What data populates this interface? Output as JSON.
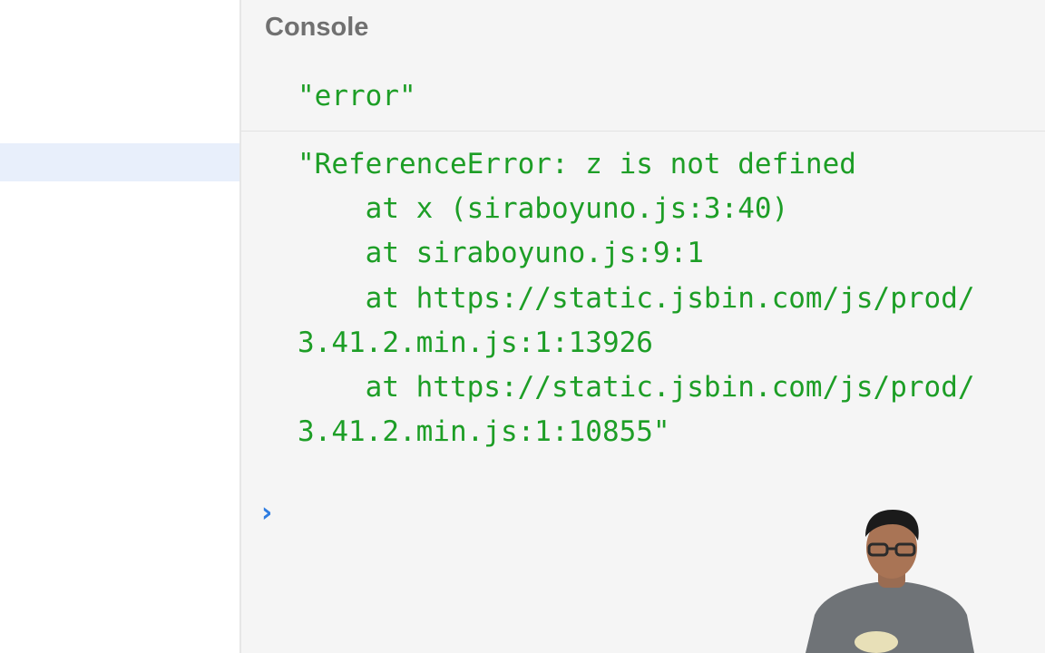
{
  "console": {
    "title": "Console",
    "entries": [
      {
        "text": "\"error\""
      },
      {
        "lines": [
          "\"ReferenceError: z is not defined",
          "    at x (siraboyuno.js:3:40)",
          "    at siraboyuno.js:9:1",
          "    at https://static.jsbin.com/js/prod/",
          "3.41.2.min.js:1:13926",
          "    at https://static.jsbin.com/js/prod/",
          "3.41.2.min.js:1:10855\""
        ]
      }
    ],
    "prompt_icon": "chevron-right-icon"
  },
  "colors": {
    "log_text": "#1d9e26",
    "prompt": "#2f7de1",
    "title": "#707070",
    "highlight": "#e8effb"
  }
}
